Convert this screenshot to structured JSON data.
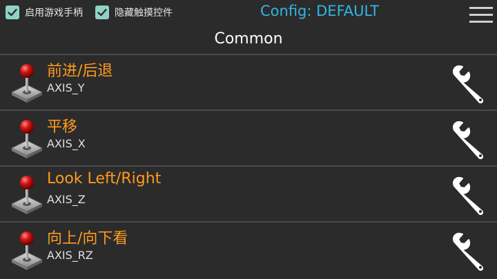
{
  "header": {
    "gamepad_checkbox": {
      "label": "启用游戏手柄",
      "checked": true
    },
    "hide_touch_checkbox": {
      "label": "隐藏触摸控件",
      "checked": true
    },
    "config_title": "Config: DEFAULT",
    "menu_icon": "hamburger-menu-icon"
  },
  "section_title": "Common",
  "items": [
    {
      "title": "前进/后退",
      "axis": "AXIS_Y",
      "icon": "joystick-icon",
      "action_icon": "wrench-icon"
    },
    {
      "title": "平移",
      "axis": "AXIS_X",
      "icon": "joystick-icon",
      "action_icon": "wrench-icon"
    },
    {
      "title": "Look Left/Right",
      "axis": "AXIS_Z",
      "icon": "joystick-icon",
      "action_icon": "wrench-icon"
    },
    {
      "title": "向上/向下看",
      "axis": "AXIS_RZ",
      "icon": "joystick-icon",
      "action_icon": "wrench-icon"
    }
  ],
  "colors": {
    "background": "#2b2b2b",
    "accent_blue": "#33b5e5",
    "title_orange": "#ff9a1f",
    "checkbox_teal": "#8fd3c7"
  }
}
